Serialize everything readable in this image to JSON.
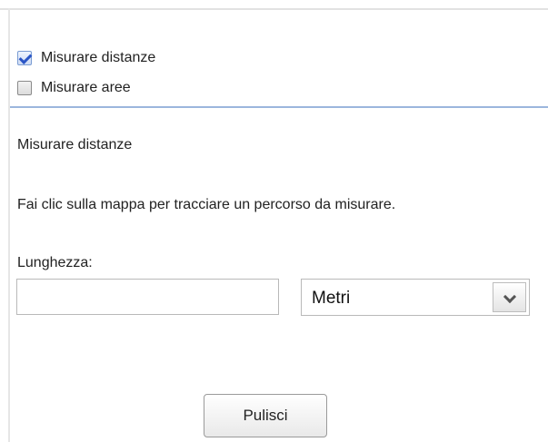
{
  "options": [
    {
      "label": "Misurare distanze",
      "checked": true
    },
    {
      "label": "Misurare aree",
      "checked": false
    }
  ],
  "panel": {
    "heading": "Misurare distanze",
    "instruction": "Fai clic sulla mappa per tracciare un percorso da misurare.",
    "length_label": "Lunghezza:",
    "length_value": "",
    "unit_selected": "Metri",
    "clear_label": "Pulisci"
  }
}
